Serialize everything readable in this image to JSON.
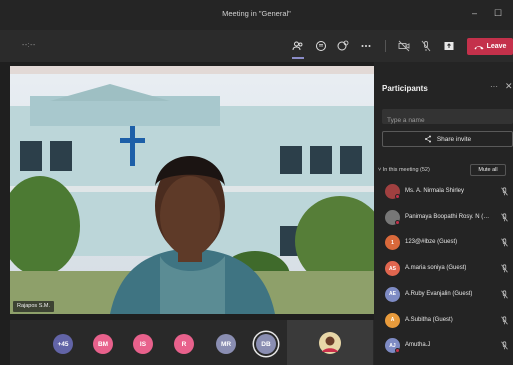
{
  "window": {
    "title": "Meeting in \"General\"",
    "minimize_glyph": "–",
    "maximize_glyph": "☐"
  },
  "toolbar": {
    "timer": "--:--",
    "leave_label": "Leave",
    "icons": [
      "participants-icon",
      "chat-icon",
      "reactions-icon",
      "more-icon",
      "camera-off-icon",
      "mic-off-icon",
      "share-tray-icon",
      "phone-icon"
    ]
  },
  "stage": {
    "name_tag": "Rajapos S.M."
  },
  "bottom_bar": {
    "avatars": [
      {
        "label": "+45",
        "color": "#6264a7"
      },
      {
        "label": "BM",
        "color": "#e8618c"
      },
      {
        "label": "IS",
        "color": "#e8618c"
      },
      {
        "label": "R",
        "color": "#e8618c"
      },
      {
        "label": "MR",
        "color": "#8a8eb2"
      },
      {
        "label": "DB",
        "color": "#8a8eb2"
      }
    ]
  },
  "participants_panel": {
    "title": "Participants",
    "more_glyph": "···",
    "close_glyph": "✕",
    "search_placeholder": "Type a name",
    "share_invite_label": "Share invite",
    "section_label": "In this meeting (52)",
    "mute_all_label": "Mute all",
    "people": [
      {
        "name": "Ms. A. Nirmala Shirley",
        "initials": "",
        "color": "#a04040",
        "status": "#c4314b"
      },
      {
        "name": "Panimaya Boopathi Rosy. N (…",
        "initials": "",
        "color": "#777777",
        "status": "#c4314b"
      },
      {
        "name": "123@#lbze (Guest)",
        "initials": "1",
        "color": "#d9693b",
        "status": ""
      },
      {
        "name": "A.maria soniya (Guest)",
        "initials": "AS",
        "color": "#e0664f",
        "status": ""
      },
      {
        "name": "A.Ruby Evanjalin (Guest)",
        "initials": "AE",
        "color": "#7e8bc4",
        "status": ""
      },
      {
        "name": "A.Subitha (Guest)",
        "initials": "A",
        "color": "#e89b3c",
        "status": ""
      },
      {
        "name": "Amutha.J",
        "initials": "AJ",
        "color": "#7e8bc4",
        "status": "#c4314b"
      }
    ]
  },
  "colors": {
    "accent": "#6264a7",
    "leave": "#c4314b",
    "panel_bg": "#242424"
  }
}
